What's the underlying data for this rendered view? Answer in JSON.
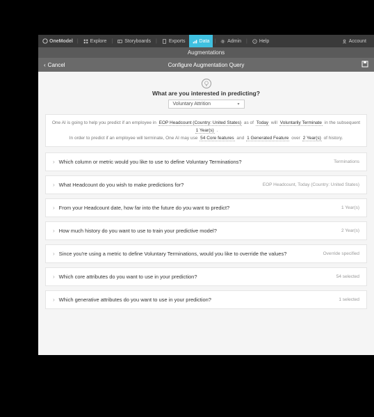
{
  "nav": {
    "brand": "OneModel",
    "items": [
      {
        "label": "Explore",
        "icon": "grid-icon",
        "active": false
      },
      {
        "label": "Storyboards",
        "icon": "storyboard-icon",
        "active": false
      },
      {
        "label": "Exports",
        "icon": "export-icon",
        "active": false
      },
      {
        "label": "Data",
        "icon": "data-icon",
        "active": true
      },
      {
        "label": "Admin",
        "icon": "gear-icon",
        "active": false
      },
      {
        "label": "Help",
        "icon": "help-icon",
        "active": false
      }
    ],
    "account": "Account"
  },
  "subheader": "Augmentations",
  "titlebar": {
    "cancel": "Cancel",
    "title": "Configure Augmentation Query",
    "save_icon": "save-icon"
  },
  "intro": {
    "title": "What are you interested in predicting?",
    "select_value": "Voluntary Attrition"
  },
  "sentence": {
    "pre1": "One AI is going to help you predict if an employee in",
    "tok1": "EOP Headcount (Country: United States)",
    "pre2": "as of",
    "tok2": "Today",
    "pre3": "will",
    "tok3": "Voluntarily Terminate",
    "pre4": "in the subsequent",
    "tok4": "1 Year(s)",
    "post1": ".",
    "line2_pre": "In order to predict if an employee will terminate, One AI may use",
    "tok5": "54 Core features",
    "mid": "and",
    "tok6": "1 Generated Feature",
    "pre5": "over",
    "tok7": "2 Year(s)",
    "post2": "of history."
  },
  "panels": [
    {
      "q": "Which column or metric would you like to use to define Voluntary Terminations?",
      "val": "Terminations"
    },
    {
      "q": "What Headcount do you wish to make predictions for?",
      "val": "EOP Headcount, Today (Country: United States)"
    },
    {
      "q": "From your Headcount date, how far into the future do you want to predict?",
      "val": "1 Year(s)"
    },
    {
      "q": "How much history do you want to use to train your predictive model?",
      "val": "2 Year(s)"
    },
    {
      "q": "Since you're using a metric to define Voluntary Terminations, would you like to override the values?",
      "val": "Override specified"
    },
    {
      "q": "Which core attributes do you want to use in your prediction?",
      "val": "54 selected"
    },
    {
      "q": "Which generative attributes do you want to use in your prediction?",
      "val": "1 selected"
    }
  ]
}
